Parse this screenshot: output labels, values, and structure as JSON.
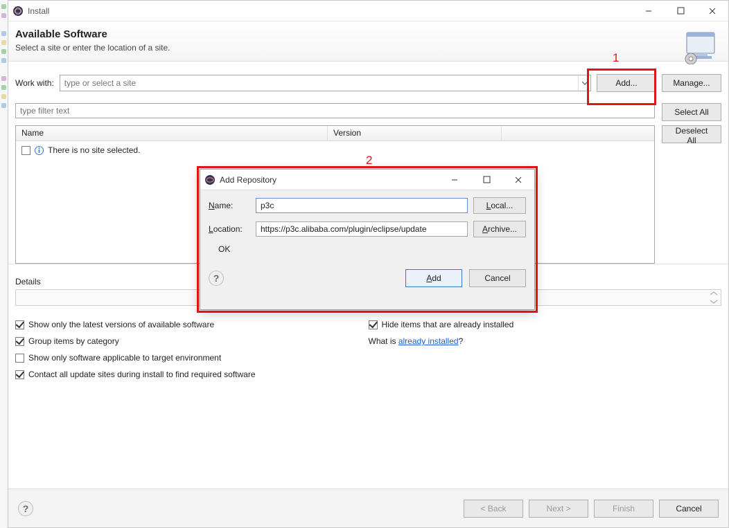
{
  "window": {
    "title": "Install",
    "header_title": "Available Software",
    "header_sub": "Select a site or enter the location of a site."
  },
  "workwith": {
    "label": "Work with:",
    "placeholder": "type or select a site",
    "add_btn": "Add...",
    "manage_btn": "Manage..."
  },
  "filter": {
    "placeholder": "type filter text",
    "select_all": "Select All",
    "deselect_all": "Deselect All"
  },
  "list": {
    "col_name": "Name",
    "col_version": "Version",
    "empty_text": "There is no site selected."
  },
  "details": {
    "label": "Details"
  },
  "options": {
    "left": [
      {
        "label": "Show only the latest versions of available software",
        "checked": true
      },
      {
        "label": "Group items by category",
        "checked": true
      },
      {
        "label": "Show only software applicable to target environment",
        "checked": false
      },
      {
        "label": "Contact all update sites during install to find required software",
        "checked": true
      }
    ],
    "right_check": {
      "label": "Hide items that are already installed",
      "checked": true
    },
    "whatis_prefix": "What is ",
    "whatis_link": "already installed",
    "whatis_suffix": "?"
  },
  "buttons": {
    "back": "< Back",
    "next": "Next >",
    "finish": "Finish",
    "cancel": "Cancel"
  },
  "modal": {
    "title": "Add Repository",
    "name_label": "Name:",
    "name_value": "p3c",
    "loc_label": "Location:",
    "loc_value": "https://p3c.alibaba.com/plugin/eclipse/update",
    "local_btn": "Local...",
    "archive_btn": "Archive...",
    "ok_text": "OK",
    "add_btn": "Add",
    "cancel_btn": "Cancel"
  },
  "annotations": {
    "one": "1",
    "two": "2"
  }
}
